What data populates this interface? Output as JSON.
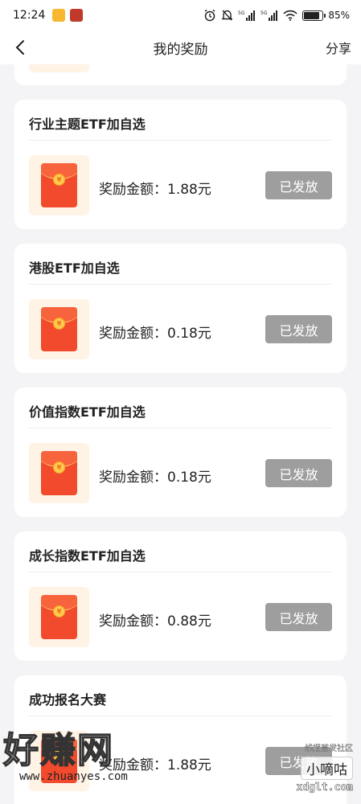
{
  "status_bar": {
    "time": "12:24",
    "battery": "85%",
    "battery_level": 0.85
  },
  "nav": {
    "title": "我的奖励",
    "share_label": "分享"
  },
  "rewards": [
    {
      "title": "行业主题ETF加自选",
      "amount": "奖励金额：1.88元",
      "status": "已发放"
    },
    {
      "title": "港股ETF加自选",
      "amount": "奖励金额：0.18元",
      "status": "已发放"
    },
    {
      "title": "价值指数ETF加自选",
      "amount": "奖励金额：0.18元",
      "status": "已发放"
    },
    {
      "title": "成长指数ETF加自选",
      "amount": "奖励金额：0.88元",
      "status": "已发放"
    },
    {
      "title": "成功报名大赛",
      "amount": "奖励金额：1.88元",
      "status": "已发放"
    }
  ],
  "watermark": {
    "left_text": "好赚网",
    "left_url": "www.zhuanyes.com",
    "right_small": "线报首发社区",
    "right_brand": "小嘀咕",
    "right_url": "xdglt.com"
  },
  "colors": {
    "button_done": "#9e9e9e",
    "envelope": "#f24a2c",
    "background": "#f4f4f6"
  }
}
